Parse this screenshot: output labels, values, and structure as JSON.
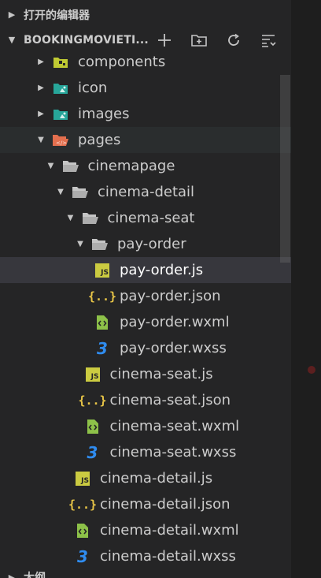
{
  "explorer": {
    "open_editors_label": "打开的编辑器",
    "project_title": "BOOKINGMOVIETI...",
    "outline_label": "大纲",
    "actions": [
      {
        "name": "new-file-icon"
      },
      {
        "name": "new-folder-icon"
      },
      {
        "name": "refresh-icon"
      },
      {
        "name": "collapse-all-icon"
      }
    ]
  },
  "tree": [
    {
      "label": "components",
      "kind": "folder",
      "icon": "components-folder-icon",
      "expanded": false,
      "depth": 0
    },
    {
      "label": "icon",
      "kind": "folder",
      "icon": "image-folder-icon",
      "expanded": false,
      "depth": 0
    },
    {
      "label": "images",
      "kind": "folder",
      "icon": "image-folder-icon",
      "expanded": false,
      "depth": 0
    },
    {
      "label": "pages",
      "kind": "folder",
      "icon": "pages-folder-icon",
      "expanded": true,
      "depth": 0,
      "state": "hover"
    },
    {
      "label": "cinemapage",
      "kind": "folder",
      "icon": "folder-open-icon",
      "expanded": true,
      "depth": 1
    },
    {
      "label": "cinema-detail",
      "kind": "folder",
      "icon": "folder-open-icon",
      "expanded": true,
      "depth": 2
    },
    {
      "label": "cinema-seat",
      "kind": "folder",
      "icon": "folder-open-icon",
      "expanded": true,
      "depth": 3
    },
    {
      "label": "pay-order",
      "kind": "folder",
      "icon": "folder-open-icon",
      "expanded": true,
      "depth": 4
    },
    {
      "label": "pay-order.js",
      "kind": "file",
      "icon": "js-file-icon",
      "depth": 5,
      "state": "selected"
    },
    {
      "label": "pay-order.json",
      "kind": "file",
      "icon": "json-file-icon",
      "depth": 5
    },
    {
      "label": "pay-order.wxml",
      "kind": "file",
      "icon": "wxml-file-icon",
      "depth": 5
    },
    {
      "label": "pay-order.wxss",
      "kind": "file",
      "icon": "wxss-file-icon",
      "depth": 5
    },
    {
      "label": "cinema-seat.js",
      "kind": "file",
      "icon": "js-file-icon",
      "depth": 4
    },
    {
      "label": "cinema-seat.json",
      "kind": "file",
      "icon": "json-file-icon",
      "depth": 4
    },
    {
      "label": "cinema-seat.wxml",
      "kind": "file",
      "icon": "wxml-file-icon",
      "depth": 4
    },
    {
      "label": "cinema-seat.wxss",
      "kind": "file",
      "icon": "wxss-file-icon",
      "depth": 4
    },
    {
      "label": "cinema-detail.js",
      "kind": "file",
      "icon": "js-file-icon",
      "depth": 3
    },
    {
      "label": "cinema-detail.json",
      "kind": "file",
      "icon": "json-file-icon",
      "depth": 3
    },
    {
      "label": "cinema-detail.wxml",
      "kind": "file",
      "icon": "wxml-file-icon",
      "depth": 3
    },
    {
      "label": "cinema-detail.wxss",
      "kind": "file",
      "icon": "wxss-file-icon",
      "depth": 3
    }
  ],
  "colors": {
    "sidebar_bg": "#252526",
    "editor_bg": "#1e1e1e",
    "selected_row": "#37373d",
    "js_icon": "#cbcb41",
    "json_icon": "#e8c547",
    "wxml_icon": "#8dc149",
    "wxss_icon": "#2f8cf0",
    "folder_icon": "#c5c5c5",
    "pages_folder_icon": "#e36f4e",
    "image_folder_icon": "#27a69a",
    "components_folder_icon": "#c0ca33"
  }
}
